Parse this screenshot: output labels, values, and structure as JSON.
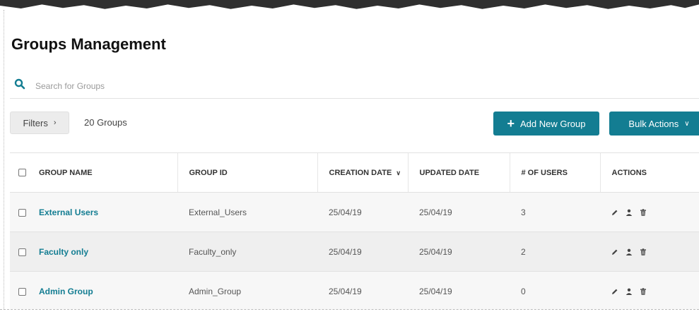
{
  "page": {
    "title": "Groups Management"
  },
  "search": {
    "placeholder": "Search for Groups"
  },
  "toolbar": {
    "filters_label": "Filters",
    "group_count": "20 Groups",
    "add_label": "Add New Group",
    "bulk_label": "Bulk Actions"
  },
  "table": {
    "headers": {
      "group_name": "GROUP NAME",
      "group_id": "GROUP ID",
      "creation_date": "CREATION DATE",
      "updated_date": "UPDATED DATE",
      "users": "# OF USERS",
      "actions": "ACTIONS"
    },
    "rows": [
      {
        "name": "External Users",
        "id": "External_Users",
        "created": "25/04/19",
        "updated": "25/04/19",
        "users": "3"
      },
      {
        "name": "Faculty only",
        "id": "Faculty_only",
        "created": "25/04/19",
        "updated": "25/04/19",
        "users": "2"
      },
      {
        "name": "Admin Group",
        "id": "Admin_Group",
        "created": "25/04/19",
        "updated": "25/04/19",
        "users": "0"
      }
    ]
  },
  "colors": {
    "accent": "#137d92"
  },
  "icons": {
    "search": "search-icon",
    "edit": "pencil-icon",
    "user": "user-icon",
    "delete": "trash-icon"
  }
}
